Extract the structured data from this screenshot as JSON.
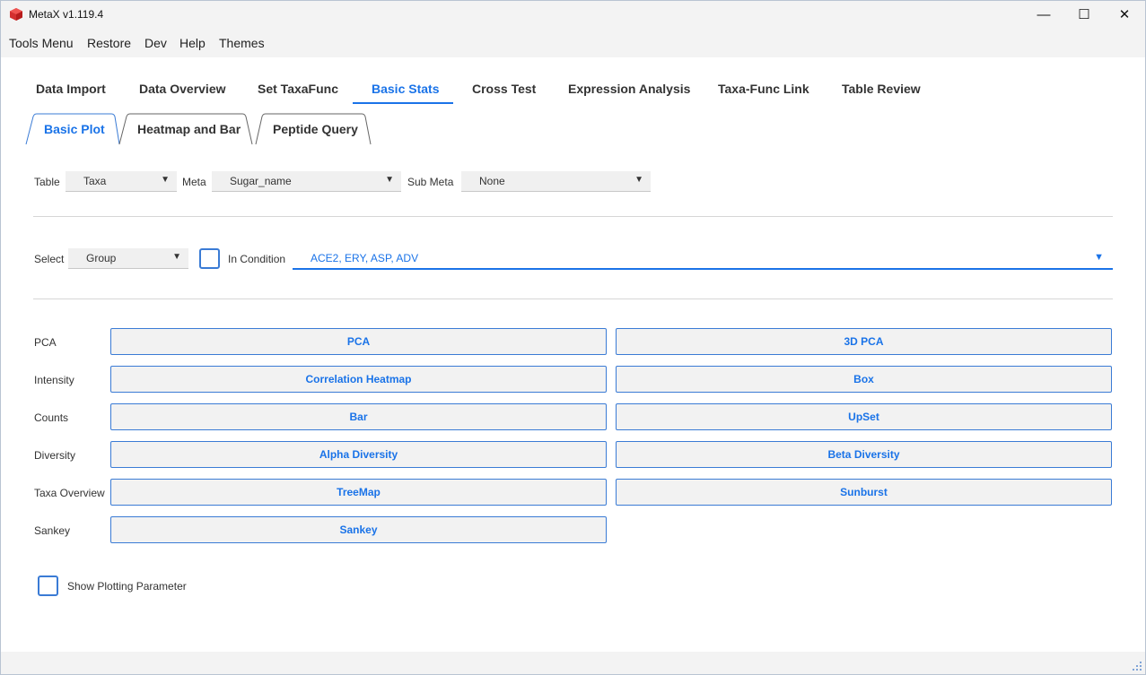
{
  "window": {
    "title": "MetaX v1.119.4",
    "controls": {
      "minimize": "—",
      "maximize": "☐",
      "close": "✕"
    }
  },
  "menu": [
    "Tools Menu",
    "Restore",
    "Dev",
    "Help",
    "Themes"
  ],
  "main_tabs": [
    "Data Import",
    "Data Overview",
    "Set TaxaFunc",
    "Basic Stats",
    "Cross Test",
    "Expression Analysis",
    "Taxa-Func Link",
    "Table Review"
  ],
  "active_main_tab": "Basic Stats",
  "sub_tabs": [
    "Basic Plot",
    "Heatmap and Bar",
    "Peptide Query"
  ],
  "active_sub_tab": "Basic Plot",
  "filters": {
    "table_label": "Table",
    "table_value": "Taxa",
    "meta_label": "Meta",
    "meta_value": "Sugar_name",
    "sub_meta_label": "Sub Meta",
    "sub_meta_value": "None"
  },
  "selection": {
    "select_label": "Select",
    "select_value": "Group",
    "in_condition_label": "In Condition",
    "in_condition_checked": false,
    "condition_value": "ACE2, ERY, ASP, ADV"
  },
  "plot_rows": [
    {
      "label": "PCA",
      "buttons": [
        "PCA",
        "3D PCA"
      ]
    },
    {
      "label": "Intensity",
      "buttons": [
        "Correlation Heatmap",
        "Box"
      ]
    },
    {
      "label": "Counts",
      "buttons": [
        "Bar",
        "UpSet"
      ]
    },
    {
      "label": "Diversity",
      "buttons": [
        "Alpha Diversity",
        "Beta Diversity"
      ]
    },
    {
      "label": "Taxa Overview",
      "buttons": [
        "TreeMap",
        "Sunburst"
      ]
    },
    {
      "label": "Sankey",
      "buttons": [
        "Sankey"
      ]
    }
  ],
  "show_plotting_parameter": {
    "label": "Show Plotting Parameter",
    "checked": false
  },
  "colors": {
    "accent": "#1a73e8",
    "border": "#3a7bd5",
    "app_icon": "#d32f2f"
  },
  "icons": {
    "app": "app-cube-icon",
    "dropdown": "chevron-down-icon",
    "resize": "resize-grip-icon"
  }
}
